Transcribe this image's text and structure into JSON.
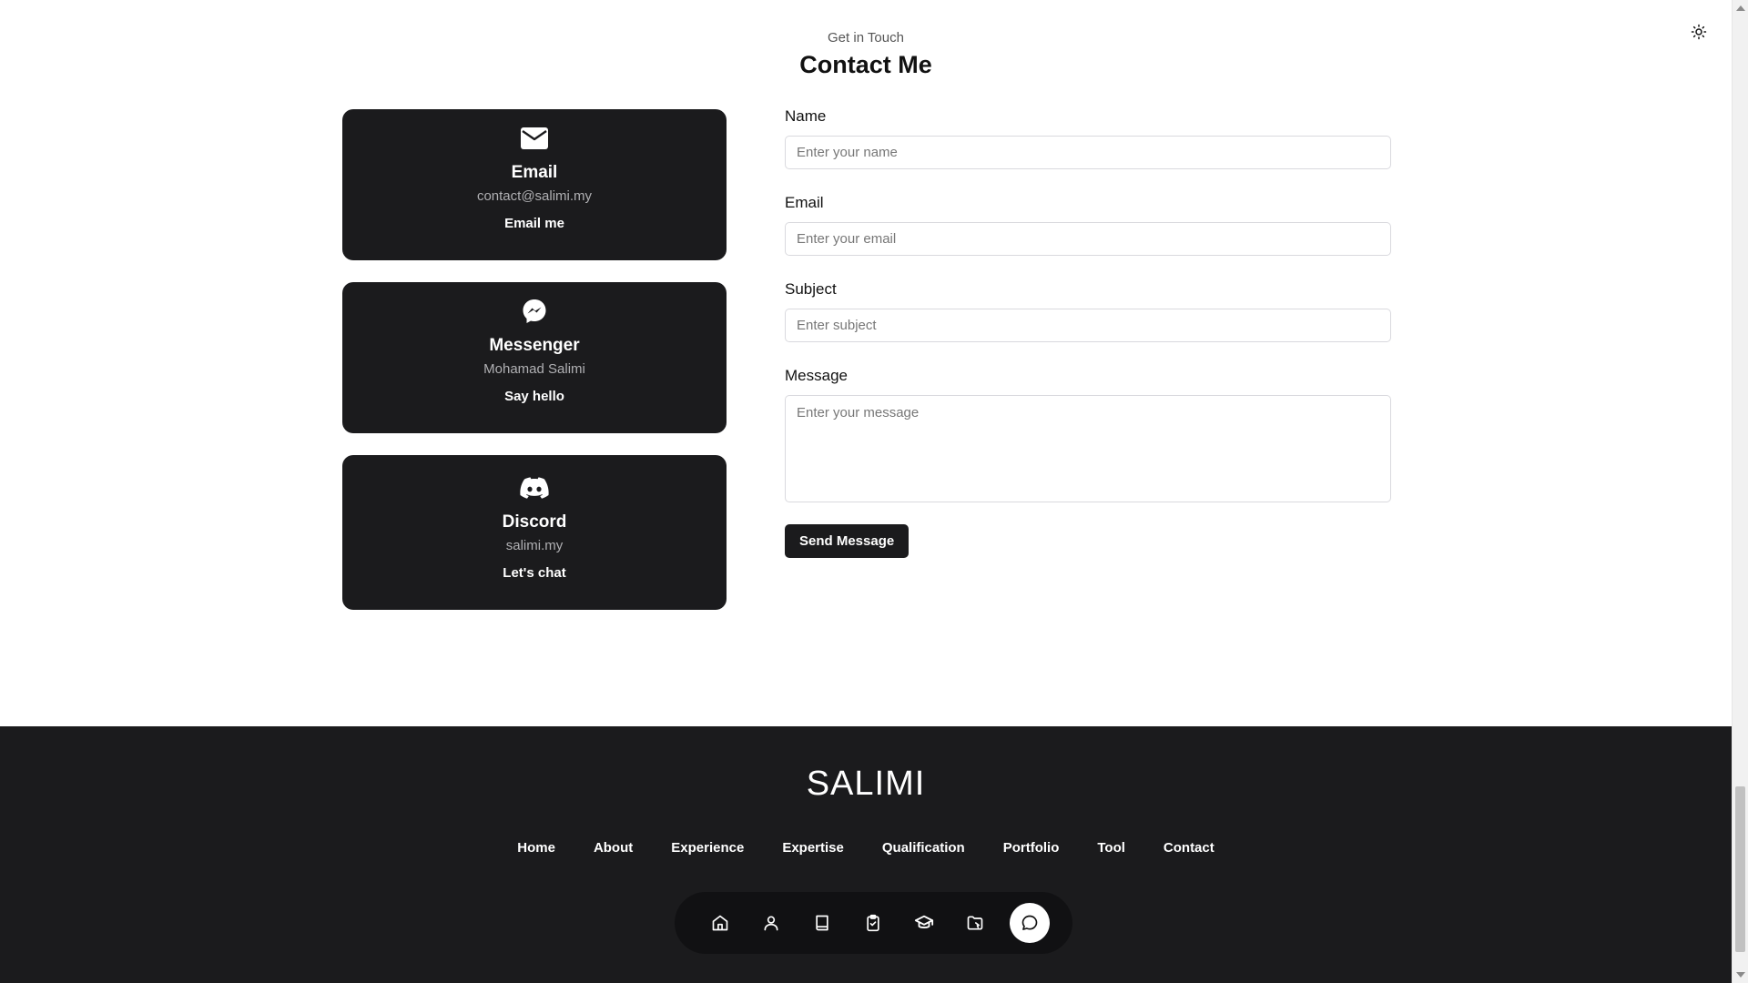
{
  "header": {
    "subtitle": "Get in Touch",
    "title": "Contact Me"
  },
  "cards": [
    {
      "icon": "envelope-icon",
      "title": "Email",
      "value": "contact@salimi.my",
      "action": "Email me"
    },
    {
      "icon": "messenger-icon",
      "title": "Messenger",
      "value": "Mohamad Salimi",
      "action": "Say hello"
    },
    {
      "icon": "discord-icon",
      "title": "Discord",
      "value": "salimi.my",
      "action": "Let's chat"
    }
  ],
  "form": {
    "name_label": "Name",
    "name_placeholder": "Enter your name",
    "email_label": "Email",
    "email_placeholder": "Enter your email",
    "subject_label": "Subject",
    "subject_placeholder": "Enter subject",
    "message_label": "Message",
    "message_placeholder": "Enter your message",
    "submit_label": "Send Message"
  },
  "footer": {
    "logo": "SALIMI",
    "nav": [
      "Home",
      "About",
      "Experience",
      "Expertise",
      "Qualification",
      "Portfolio",
      "Tool",
      "Contact"
    ]
  },
  "dock": {
    "items": [
      "home-icon",
      "user-icon",
      "book-icon",
      "clipboard-check-icon",
      "graduation-cap-icon",
      "folder-icon",
      "message-circle-icon"
    ],
    "active": "message-circle-icon"
  },
  "colors": {
    "card_bg": "#1b1b1d",
    "footer_bg": "#1b1b1d",
    "accent": "#111111"
  },
  "theme_toggle_icon": "sun-icon"
}
